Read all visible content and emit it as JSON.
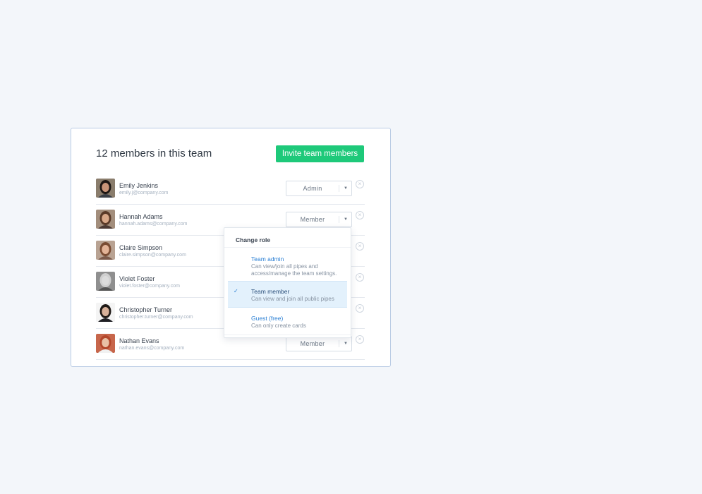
{
  "card": {
    "title": "12 members in this team",
    "invite_label": "Invite team members"
  },
  "members": [
    {
      "name": "Emily Jenkins",
      "email": "emily.j@company.com",
      "role": "Admin",
      "avatar": {
        "hair": "#1e1714",
        "skin": "#c99478",
        "bg": "#8a7d6c",
        "shirt": "#3b3f46"
      }
    },
    {
      "name": "Hannah Adams",
      "email": "hannah.adams@company.com",
      "role": "Member",
      "avatar": {
        "hair": "#5a3a28",
        "skin": "#d8a889",
        "bg": "#a38e7c",
        "shirt": "#4c3a34"
      }
    },
    {
      "name": "Claire Simpson",
      "email": "claire.simpson@company.com",
      "role": "",
      "avatar": {
        "hair": "#7a4c33",
        "skin": "#e3b397",
        "bg": "#b9a393",
        "shirt": "#7b5a4b"
      }
    },
    {
      "name": "Violet Foster",
      "email": "violet.foster@company.com",
      "role": "",
      "avatar": {
        "hair": "#cfcfcf",
        "skin": "#dcdcdc",
        "bg": "#8f8f8f",
        "shirt": "#555555"
      }
    },
    {
      "name": "Christopher Turner",
      "email": "christopher.turner@company.com",
      "role": "",
      "avatar": {
        "hair": "#201a17",
        "skin": "#d8b19a",
        "bg": "#f4f4f4",
        "shirt": "#1f1f24"
      }
    },
    {
      "name": "Nathan Evans",
      "email": "nathan.evans@company.com",
      "role": "Member",
      "avatar": {
        "hair": "#b3472b",
        "skin": "#e9c0a5",
        "bg": "#c7664b",
        "shirt": "#f1f1f1"
      }
    }
  ],
  "dropdown": {
    "header": "Change role",
    "options": [
      {
        "title": "Team admin",
        "desc": "Can view/join all pipes and access/manage the team settings.",
        "selected": false
      },
      {
        "title": "Team member",
        "desc": "Can view and join all public pipes",
        "selected": true
      },
      {
        "title": "Guest (free)",
        "desc": "Can only create cards",
        "selected": false
      }
    ],
    "check_glyph": "✓"
  },
  "icons": {
    "caret": "▼",
    "remove": "×"
  },
  "colors": {
    "accent_green": "#1ec97a",
    "link_blue": "#2a7fd4",
    "selected_bg": "#e3f1fc",
    "card_border": "#b9cbe4"
  }
}
